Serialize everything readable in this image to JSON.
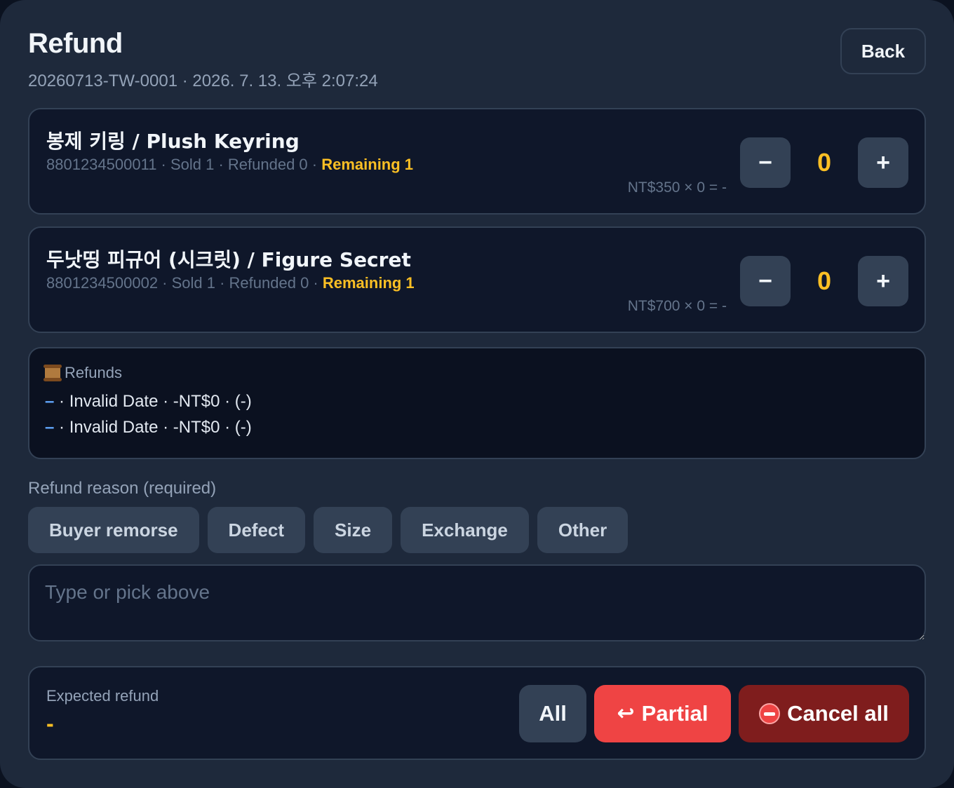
{
  "header": {
    "title": "Refund",
    "subtitle": "20260713-TW-0001 · 2026. 7. 13. 오후 2:07:24",
    "back_label": "Back"
  },
  "items": [
    {
      "name": "봉제 키링 / Plush Keyring",
      "meta": "8801234500011 · Sold 1 · Refunded 0 · ",
      "remaining": "Remaining 1",
      "price_line": "NT$350 × 0 = -",
      "minus_label": "−",
      "qty": "0",
      "plus_label": "+"
    },
    {
      "name": "두낫띵 피규어 (시크릿) / Figure Secret",
      "meta": "8801234500002 · Sold 1 · Refunded 0 · ",
      "remaining": "Remaining 1",
      "price_line": "NT$700 × 0 = -",
      "minus_label": "−",
      "qty": "0",
      "plus_label": "+"
    }
  ],
  "history": {
    "title": "Refunds",
    "icon": "scroll-icon",
    "rows": [
      {
        "dash": "–",
        "text": " · Invalid Date · -NT$0 · (-)"
      },
      {
        "dash": "–",
        "text": " · Invalid Date · -NT$0 · (-)"
      }
    ]
  },
  "reason": {
    "label": "Refund reason (required)",
    "chips": [
      "Buyer remorse",
      "Defect",
      "Size",
      "Exchange",
      "Other"
    ],
    "placeholder": "Type or pick above",
    "value": ""
  },
  "footer": {
    "expected_label": "Expected refund",
    "expected_value": "-",
    "all_label": "All",
    "partial_label": "Partial",
    "partial_icon": "return-arrow-icon",
    "cancel_label": "Cancel all",
    "cancel_icon": "no-entry-icon"
  },
  "colors": {
    "accent": "#fbbf24",
    "danger": "#ef4444",
    "danger_dark": "#7f1d1d",
    "panel": "#1e293b",
    "card": "#0f172a"
  }
}
